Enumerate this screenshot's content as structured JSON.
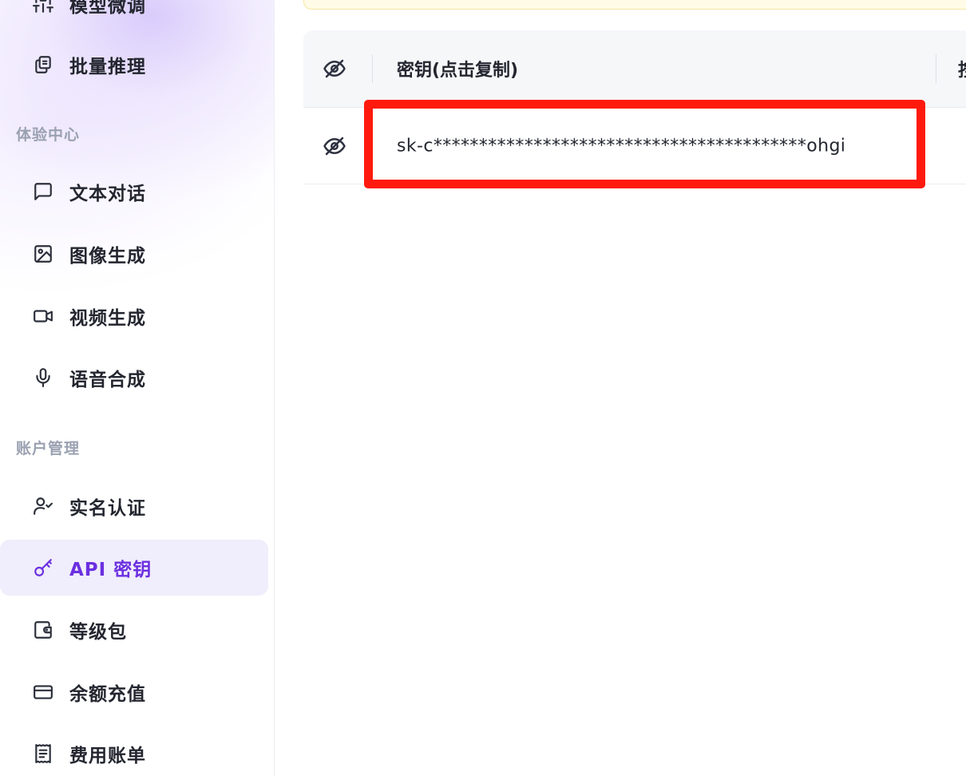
{
  "sidebar": {
    "top_partial_item": {
      "label": "模型微调",
      "icon": "sliders-icon"
    },
    "batch_item": {
      "label": "批量推理",
      "icon": "copy-icon"
    },
    "section_experience": "体验中心",
    "experience_items": [
      {
        "label": "文本对话",
        "icon": "message-square-icon"
      },
      {
        "label": "图像生成",
        "icon": "image-icon"
      },
      {
        "label": "视频生成",
        "icon": "video-icon"
      },
      {
        "label": "语音合成",
        "icon": "mic-icon"
      }
    ],
    "section_account": "账户管理",
    "account_items": [
      {
        "label": "实名认证",
        "icon": "user-check-icon"
      },
      {
        "label": "API 密钥",
        "icon": "key-icon",
        "active": true
      },
      {
        "label": "等级包",
        "icon": "wallet-icon"
      },
      {
        "label": "余额充值",
        "icon": "credit-card-icon"
      },
      {
        "label": "费用账单",
        "icon": "receipt-icon"
      }
    ],
    "active_color": "#6b2fe0"
  },
  "table": {
    "header": {
      "key_column": "密钥(点击复制)",
      "next_column_partial": "按"
    },
    "rows": [
      {
        "key": "sk-c*****************************************ohgi"
      }
    ]
  },
  "highlight_color": "#ff1a0d"
}
